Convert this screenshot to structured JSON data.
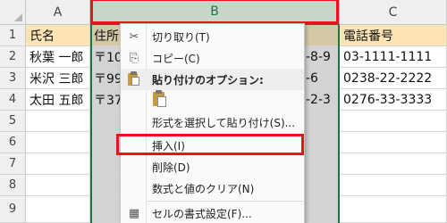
{
  "columns": [
    "A",
    "B",
    "C"
  ],
  "rows": [
    "1",
    "2",
    "3",
    "4",
    "5",
    "6",
    "7",
    "8",
    "9"
  ],
  "table": [
    {
      "a": "氏名",
      "b": "住所",
      "b_tail": "",
      "c": "電話番号"
    },
    {
      "a": "秋葉 一郎",
      "b": "〒10",
      "b_tail": "-8-9",
      "c": "03-1111-1111"
    },
    {
      "a": "米沢 三郎",
      "b": "〒99",
      "b_tail": "-6",
      "c": "0238-22-2222"
    },
    {
      "a": "太田 五郎",
      "b": "〒37",
      "b_tail": "-2-3",
      "c": "0276-33-3333"
    }
  ],
  "context_menu": {
    "cut": "切り取り(T)",
    "copy": "コピー(C)",
    "paste_options_heading": "貼り付けのオプション:",
    "paste_special": "形式を選択して貼り付け(S)...",
    "insert": "挿入(I)",
    "delete": "削除(D)",
    "clear_contents": "数式と値のクリア(N)",
    "format_cells": "セルの書式設定(F)..."
  },
  "colors": {
    "highlight": "#e8141c",
    "excel_green": "#217346",
    "header_fill": "#fce4b6"
  }
}
